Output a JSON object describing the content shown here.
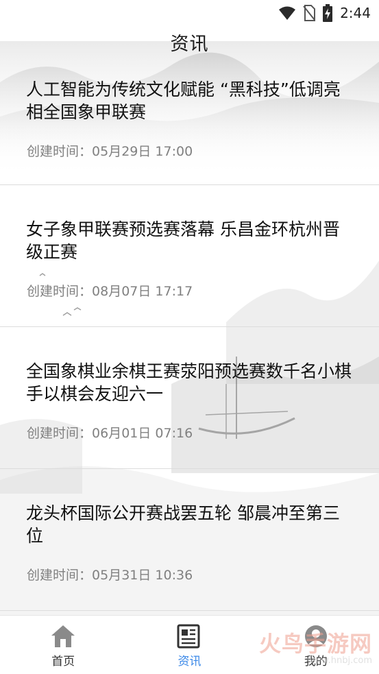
{
  "status_bar": {
    "time": "2:44",
    "icons": [
      "wifi-icon",
      "no-sim-icon",
      "battery-charging-icon"
    ]
  },
  "header": {
    "title": "资讯"
  },
  "news": [
    {
      "title": "人工智能为传统文化赋能 “黑科技”低调亮相全国象甲联赛",
      "meta_label": "创建时间：",
      "date": "05月29日 17:00"
    },
    {
      "title": "女子象甲联赛预选赛落幕 乐昌金环杭州晋级正赛",
      "meta_label": "创建时间：",
      "date": "08月07日 17:17"
    },
    {
      "title": "全国象棋业余棋王赛荥阳预选赛数千名小棋手以棋会友迎六一",
      "meta_label": "创建时间：",
      "date": "06月01日 07:16"
    },
    {
      "title": "龙头杯国际公开赛战罢五轮 邹晨冲至第三位",
      "meta_label": "创建时间：",
      "date": "05月31日 10:36"
    }
  ],
  "bottom_nav": {
    "active_color": "#3a88e8",
    "tabs": [
      {
        "label": "首页",
        "icon": "home-icon"
      },
      {
        "label": "资讯",
        "icon": "news-icon"
      },
      {
        "label": "我的",
        "icon": "profile-icon"
      }
    ]
  },
  "watermark": {
    "text": "火鸟手游网",
    "url": "www.hnbj.com"
  }
}
